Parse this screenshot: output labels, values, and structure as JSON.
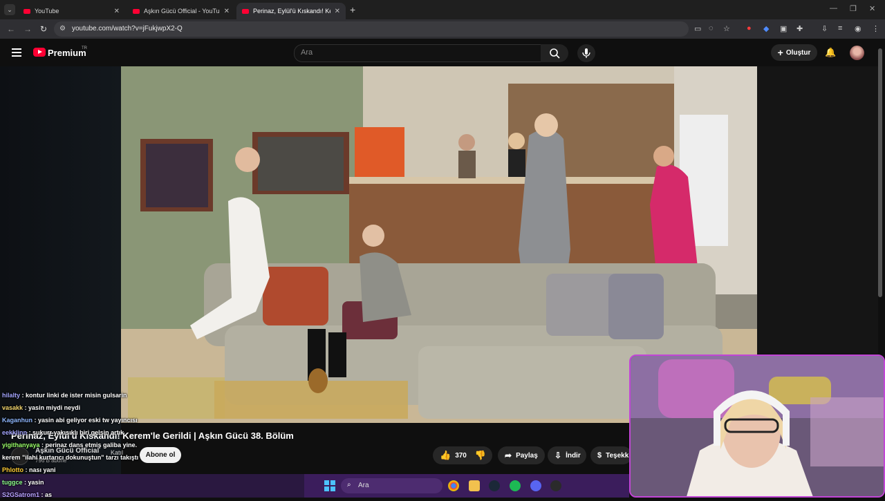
{
  "browser": {
    "tabs": [
      {
        "title": "YouTube"
      },
      {
        "title": "Aşkın Gücü Official - YouTube"
      },
      {
        "title": "Perinaz, Eylül'ü Kıskandı! Keren"
      }
    ],
    "url": "youtube.com/watch?v=jFukjwpX2-Q"
  },
  "yt": {
    "brand": "Premium",
    "region": "TR",
    "search_placeholder": "Ara",
    "create_label": "Oluştur"
  },
  "video": {
    "title": "Perinaz, Eylül'ü Kıskandı! Kerem'le Gerildi | Aşkın Gücü 38. Bölüm",
    "channel": "Aşkın Gücü Official",
    "subscribers": "796 B abone",
    "join_label": "Katıl",
    "subscribe_label": "Abone ol",
    "likes": "370",
    "share_label": "Paylaş",
    "download_label": "İndir",
    "thanks_label": "Teşekk"
  },
  "chat": [
    {
      "user": "hilalty",
      "msg": "kontur linki de ister misin gulsarin",
      "color": "#a5a6ff"
    },
    {
      "user": "vasakk",
      "msg": "yasin miydi neydi",
      "color": "#f5d76e"
    },
    {
      "user": "Kaganhun",
      "msg": "yasin abi geliyor eski tw yayıncısı",
      "color": "#8fb8ff"
    },
    {
      "user": "eekklinn",
      "msg": "şukurr yakısıklı biri gelsin artık",
      "color": "#a5a6ff"
    },
    {
      "user": "yigithanyaya",
      "msg": "perinaz dans etmiş galiba yine.",
      "color": "#9bff6a"
    },
    {
      "user": "",
      "msg": "kerem \"ilahi kurtarıcı dokunuştun\" tarzı takıştı",
      "color": "#ffffff"
    },
    {
      "user": "Phlotto",
      "msg": "nası yani",
      "color": "#ffcc33"
    },
    {
      "user": "tuggce",
      "msg": "yasin",
      "color": "#8fff8f"
    },
    {
      "user": "S2GSatrom1",
      "msg": "as",
      "color": "#b9a3ff"
    }
  ],
  "taskbar": {
    "search_label": "Ara"
  }
}
